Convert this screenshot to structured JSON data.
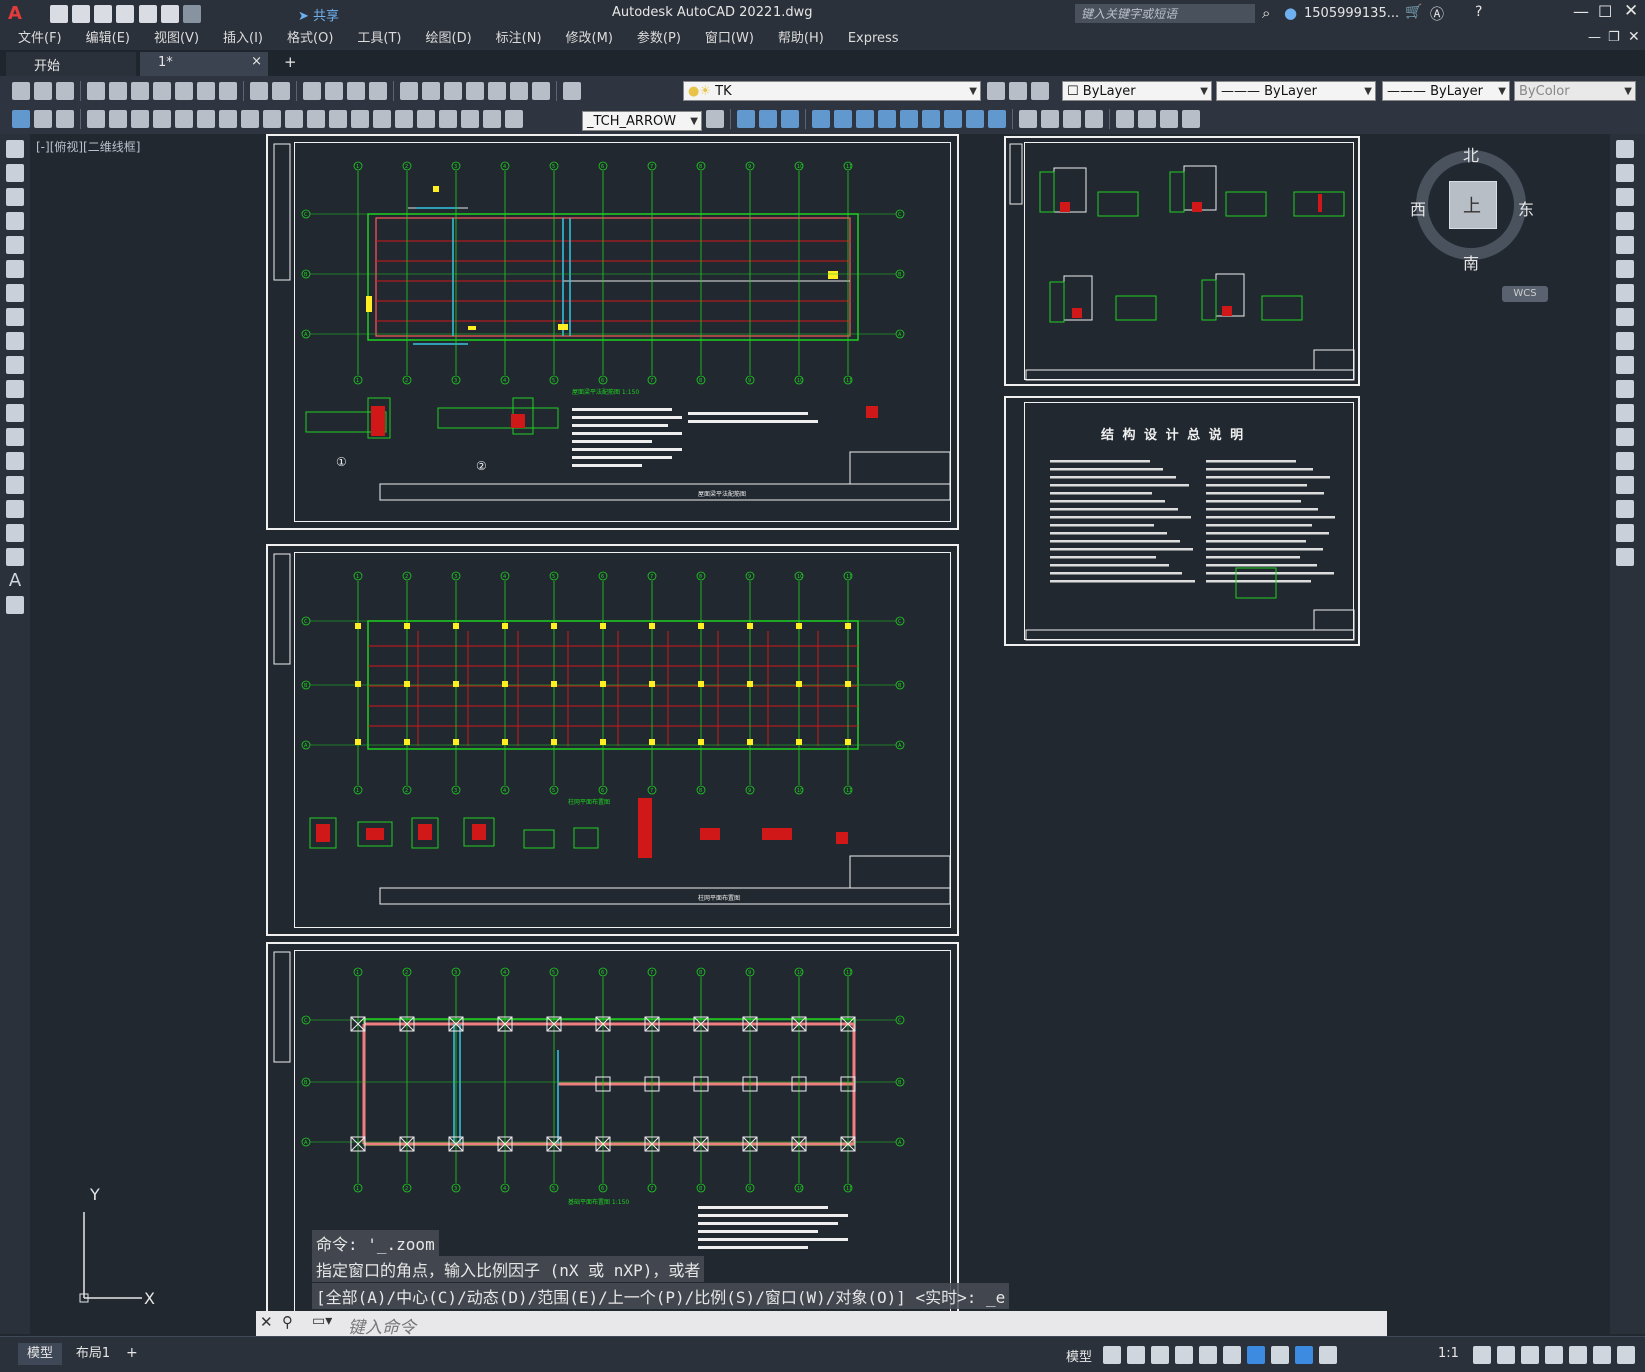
{
  "titlebar": {
    "app_title": "Autodesk AutoCAD 2022",
    "file_name": "1.dwg",
    "share_label": "共享",
    "search_placeholder": "键入关键字或短语",
    "user_name": "1505999135...",
    "app_logo_letter": "A"
  },
  "menu": {
    "items": [
      "文件(F)",
      "编辑(E)",
      "视图(V)",
      "插入(I)",
      "格式(O)",
      "工具(T)",
      "绘图(D)",
      "标注(N)",
      "修改(M)",
      "参数(P)",
      "窗口(W)",
      "帮助(H)",
      "Express"
    ]
  },
  "tabs": {
    "start": "开始",
    "drawing": "1*",
    "close_icon": "×",
    "add_icon": "+"
  },
  "toolbar": {
    "layer_value": "TK",
    "color_value": "ByLayer",
    "linetype_value": "ByLayer",
    "lineweight_value": "ByLayer",
    "plotstyle_value": "ByColor",
    "dimstyle_value": "_TCH_ARROW"
  },
  "viewport": {
    "label": "[-][俯视][二维线框]"
  },
  "viewcube": {
    "north": "北",
    "south": "南",
    "east": "东",
    "west": "西",
    "top": "上",
    "wcs": "WCS"
  },
  "drawings": {
    "sheet1_caption": "屋面梁平法配筋图 1:150",
    "sheet1_title": "屋面梁平法配筋图",
    "sheet2_caption": "柱网平面布置图",
    "sheet2_title": "柱网平面布置图",
    "sheet3_caption": "基础平面布置图 1:150",
    "sheet5_title": "结 构 设 计 总 说 明",
    "grid_labels": [
      "1",
      "2",
      "3",
      "4",
      "5",
      "6",
      "7",
      "8",
      "9",
      "10",
      "11"
    ],
    "row_labels": [
      "C",
      "B",
      "A"
    ],
    "detail_1": "①",
    "detail_2": "②"
  },
  "ucs": {
    "y": "Y",
    "x": "X"
  },
  "command": {
    "line1": "命令: '_.zoom",
    "line2": "指定窗口的角点，输入比例因子 (nX 或 nXP)，或者",
    "line3": "[全部(A)/中心(C)/动态(D)/范围(E)/上一个(P)/比例(S)/窗口(W)/对象(O)] <实时>: _e",
    "input_placeholder": "键入命令"
  },
  "layout_tabs": {
    "model": "模型",
    "layout1": "布局1",
    "add": "+"
  },
  "status": {
    "model_label": "模型",
    "scale_label": "1:1"
  }
}
